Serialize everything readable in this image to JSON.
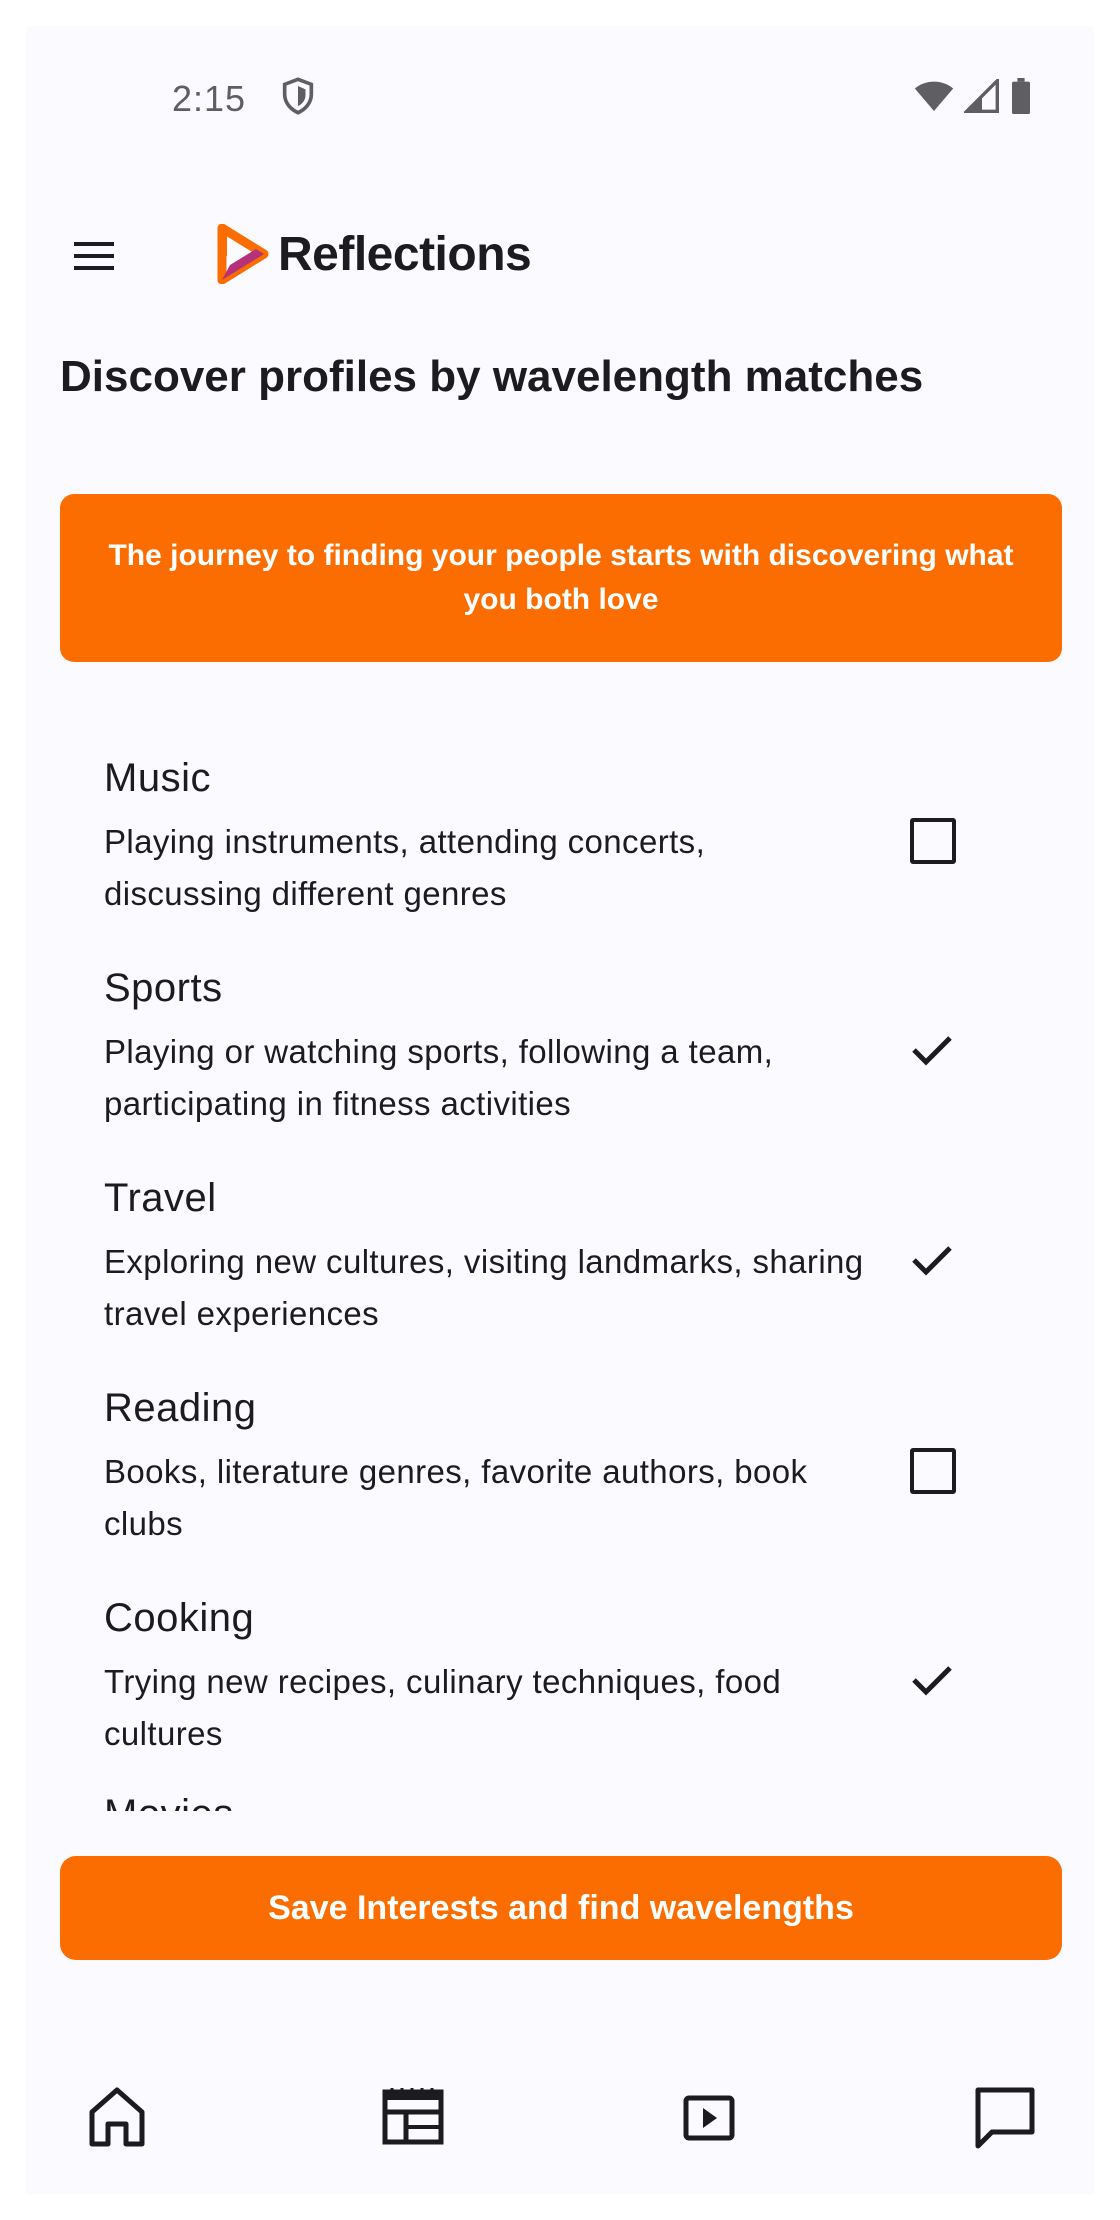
{
  "status_bar": {
    "time": "2:15",
    "icons": [
      "shield-icon",
      "wifi-icon",
      "signal-icon",
      "battery-icon"
    ]
  },
  "app_bar": {
    "menu_icon": "menu-icon",
    "brand_name": "Reflections",
    "logo_colors": {
      "primary": "#fb6d00",
      "secondary": "#b5327a"
    }
  },
  "page": {
    "title": "Discover profiles by wavelength matches"
  },
  "banner": {
    "text": "The journey to finding your people starts with discovering what you both love"
  },
  "interests": [
    {
      "title": "Music",
      "description": "Playing instruments, attending concerts, discussing different genres",
      "selected": false
    },
    {
      "title": "Sports",
      "description": "Playing or watching sports, following a team, participating in fitness activities",
      "selected": true
    },
    {
      "title": "Travel",
      "description": "Exploring new cultures, visiting landmarks, sharing travel experiences",
      "selected": true
    },
    {
      "title": "Reading",
      "description": "Books, literature genres, favorite authors, book clubs",
      "selected": false
    },
    {
      "title": "Cooking",
      "description": "Trying new recipes, culinary techniques, food cultures",
      "selected": true
    },
    {
      "title": "Movies",
      "description": "",
      "selected": false
    }
  ],
  "actions": {
    "save_label": "Save Interests and find wavelengths"
  },
  "bottom_nav": {
    "items": [
      "home-icon",
      "calendar-table-icon",
      "play-video-icon",
      "chat-icon"
    ]
  },
  "colors": {
    "accent": "#fb6d00",
    "background": "#fbfaff",
    "text": "#1c1b1f"
  }
}
